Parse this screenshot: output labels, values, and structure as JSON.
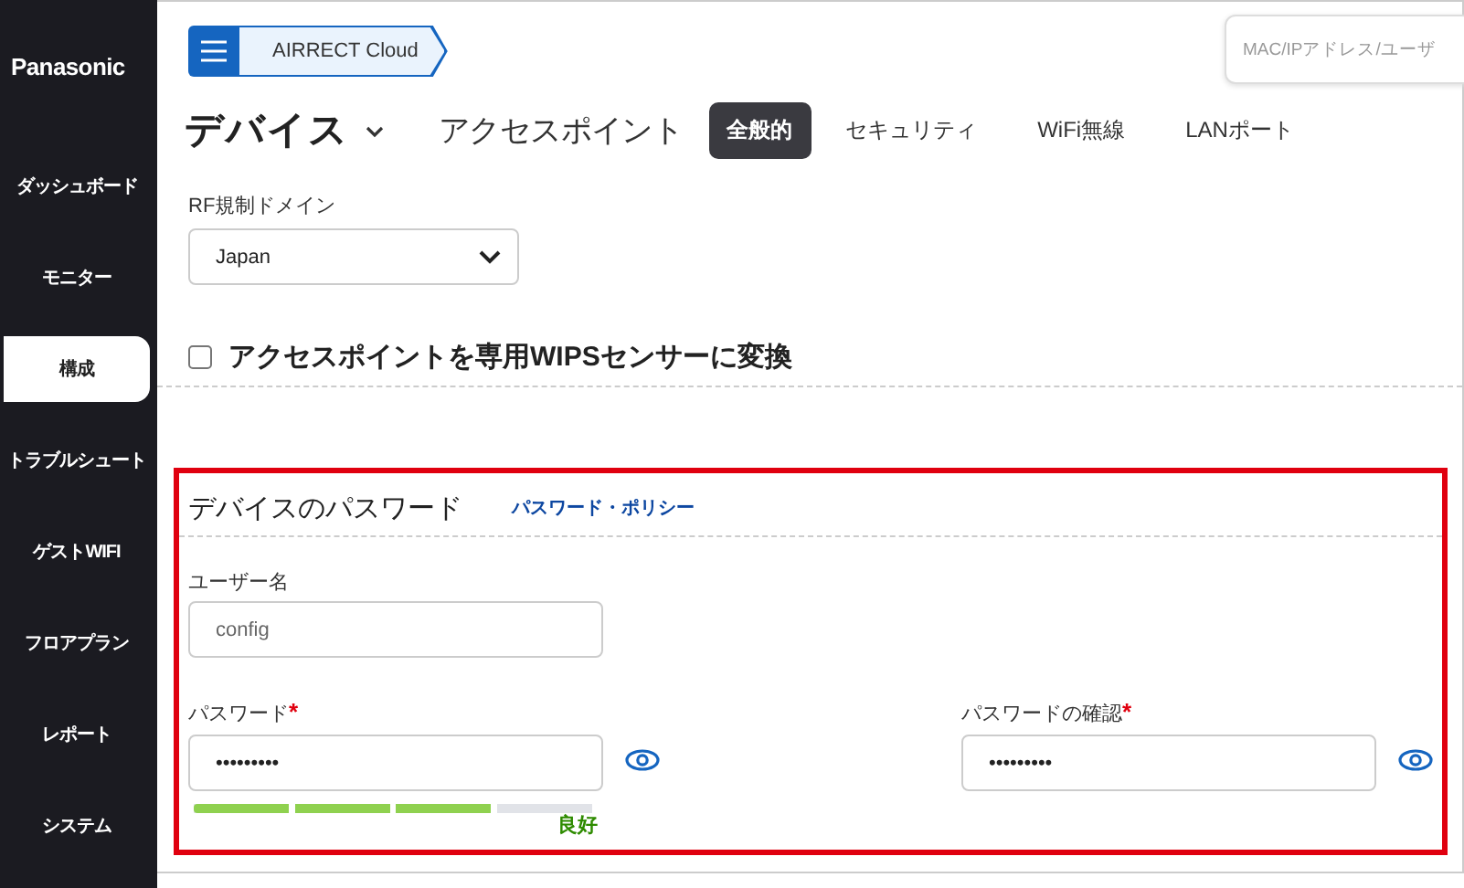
{
  "sidebar": {
    "logo": "Panasonic",
    "items": [
      {
        "label": "ダッシュボード",
        "selected": false
      },
      {
        "label": "モニター",
        "selected": false
      },
      {
        "label": "構成",
        "selected": true
      },
      {
        "label": "トラブルシュート",
        "selected": false
      },
      {
        "label": "ゲストWIFI",
        "selected": false
      },
      {
        "label": "フロアプラン",
        "selected": false
      },
      {
        "label": "レポート",
        "selected": false
      },
      {
        "label": "システム",
        "selected": false
      }
    ]
  },
  "breadcrumb": {
    "label": "AIRRECT Cloud"
  },
  "search": {
    "placeholder": "MAC/IPアドレス/ユーザ"
  },
  "page_title": "デバイス",
  "subtitle": "アクセスポイント",
  "tabs": [
    {
      "label": "全般的",
      "selected": true
    },
    {
      "label": "セキュリティ",
      "selected": false
    },
    {
      "label": "WiFi無線",
      "selected": false
    },
    {
      "label": "LANポート",
      "selected": false
    }
  ],
  "rf_domain": {
    "label": "RF規制ドメイン",
    "value": "Japan"
  },
  "wips_checkbox": {
    "label": "アクセスポイントを専用WIPSセンサーに変換",
    "checked": false
  },
  "password_panel": {
    "title": "デバイスのパスワード",
    "policy_link": "パスワード・ポリシー",
    "username": {
      "label": "ユーザー名",
      "value": "config"
    },
    "fields": [
      {
        "label": "パスワード",
        "required_mark": "*",
        "value": "•••••••••"
      },
      {
        "label": "パスワードの確認",
        "required_mark": "*",
        "value": "•••••••••"
      }
    ],
    "strength": {
      "level": 0.75,
      "label": "良好"
    }
  }
}
